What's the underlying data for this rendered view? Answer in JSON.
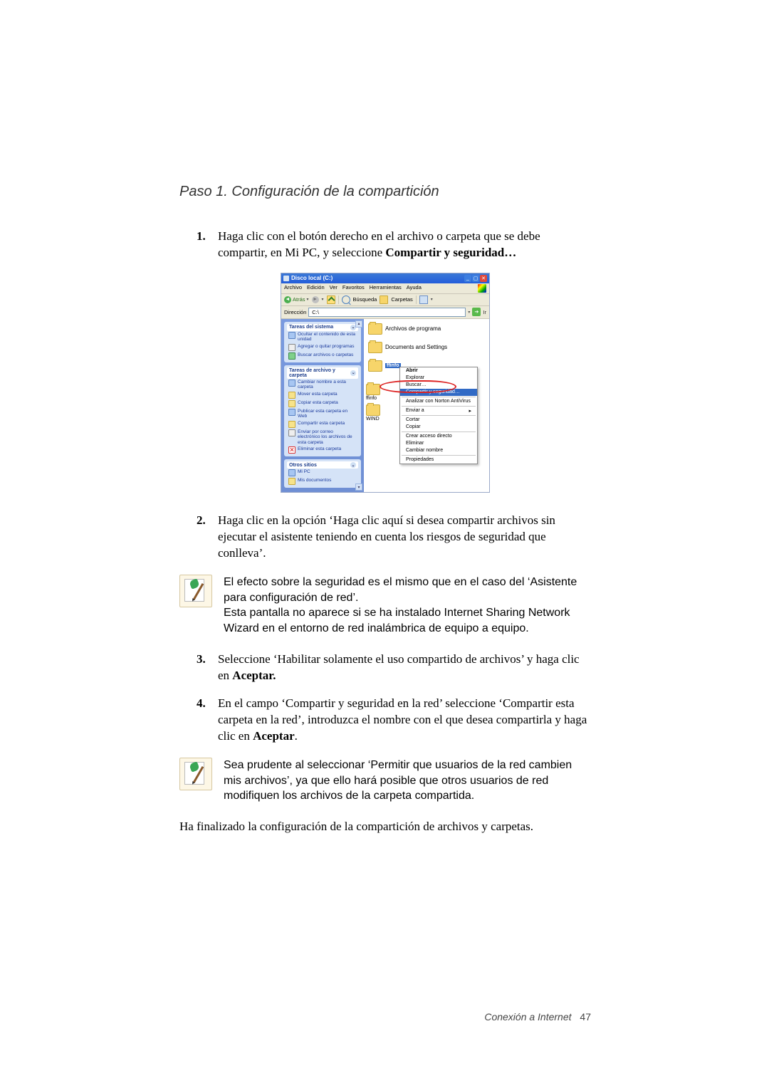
{
  "page": {
    "section_title": "Paso 1. Configuración de la compartición",
    "closing": "Ha finalizado la configuración de la compartición de archivos y carpetas.",
    "footer_label": "Conexión a Internet",
    "footer_page": "47"
  },
  "steps": {
    "s1": {
      "num": "1.",
      "text_a": "Haga clic con el botón derecho en el archivo o carpeta que se debe compartir, en Mi PC, y seleccione ",
      "bold": "Compartir y seguridad…"
    },
    "s2": {
      "num": "2.",
      "text": "Haga clic en la opción ‘Haga clic aquí si desea compartir archivos sin ejecutar el asistente teniendo en cuenta los riesgos de seguridad que conlleva’."
    },
    "s3": {
      "num": "3.",
      "text_a": "Seleccione ‘Habilitar solamente el uso compartido de archivos’ y haga clic en ",
      "bold": "Aceptar."
    },
    "s4": {
      "num": "4.",
      "text_a": "En el campo ‘Compartir y seguridad en la red’ seleccione ‘Compartir esta carpeta en la red’, introduzca el nombre con el que desea compartirla y haga clic en ",
      "bold": "Aceptar",
      "text_b": "."
    }
  },
  "notes": {
    "n1": {
      "line1": "El efecto sobre la seguridad es el mismo que en el caso del ‘Asistente para configuración de red’.",
      "line2": "Esta pantalla no aparece si se ha instalado Internet Sharing Network Wizard en el entorno de red inalámbrica de equipo a equipo."
    },
    "n2": {
      "line1": "Sea prudente al seleccionar ‘Permitir que usuarios de la red cambien mis archivos’, ya que ello hará posible que otros usuarios de red modifiquen los archivos de la carpeta compartida."
    }
  },
  "xp": {
    "title": "Disco local (C:)",
    "menu": {
      "archivo": "Archivo",
      "edicion": "Edición",
      "ver": "Ver",
      "favoritos": "Favoritos",
      "herramientas": "Herramientas",
      "ayuda": "Ayuda"
    },
    "toolbar": {
      "atras": "Atrás",
      "busqueda": "Búsqueda",
      "carpetas": "Carpetas"
    },
    "addr": {
      "label": "Dirección",
      "value": "C:\\",
      "go": "Ir"
    },
    "tasks": {
      "sys_hdr": "Tareas del sistema",
      "sys1": "Ocultar el contenido de esta unidad",
      "sys2": "Agregar o quitar programas",
      "sys3": "Buscar archivos o carpetas",
      "file_hdr": "Tareas de archivo y carpeta",
      "f1": "Cambiar nombre a esta carpeta",
      "f2": "Mover esta carpeta",
      "f3": "Copiar esta carpeta",
      "f4": "Publicar esta carpeta en Web",
      "f5": "Compartir esta carpeta",
      "f6": "Enviar por correo electrónico los archivos de esta carpeta",
      "f7": "Eliminar esta carpeta",
      "other_hdr": "Otros sitios",
      "o1": "Mi PC",
      "o2": "Mis documentos"
    },
    "content": {
      "f1": "Archivos de programa",
      "f2": "Documents and Settings",
      "sel_folder": "ffinfo",
      "truncA": "ffinfo",
      "truncB": "WIND"
    },
    "ctx": {
      "abrir": "Abrir",
      "explorar": "Explorar",
      "buscar": "Buscar…",
      "compartir": "Compartir y seguridad…",
      "norton": "Analizar con Norton AntiVirus",
      "enviar": "Enviar a",
      "cortar": "Cortar",
      "copiar": "Copiar",
      "acceso": "Crear acceso directo",
      "eliminar": "Eliminar",
      "renombrar": "Cambiar nombre",
      "prop": "Propiedades"
    }
  }
}
